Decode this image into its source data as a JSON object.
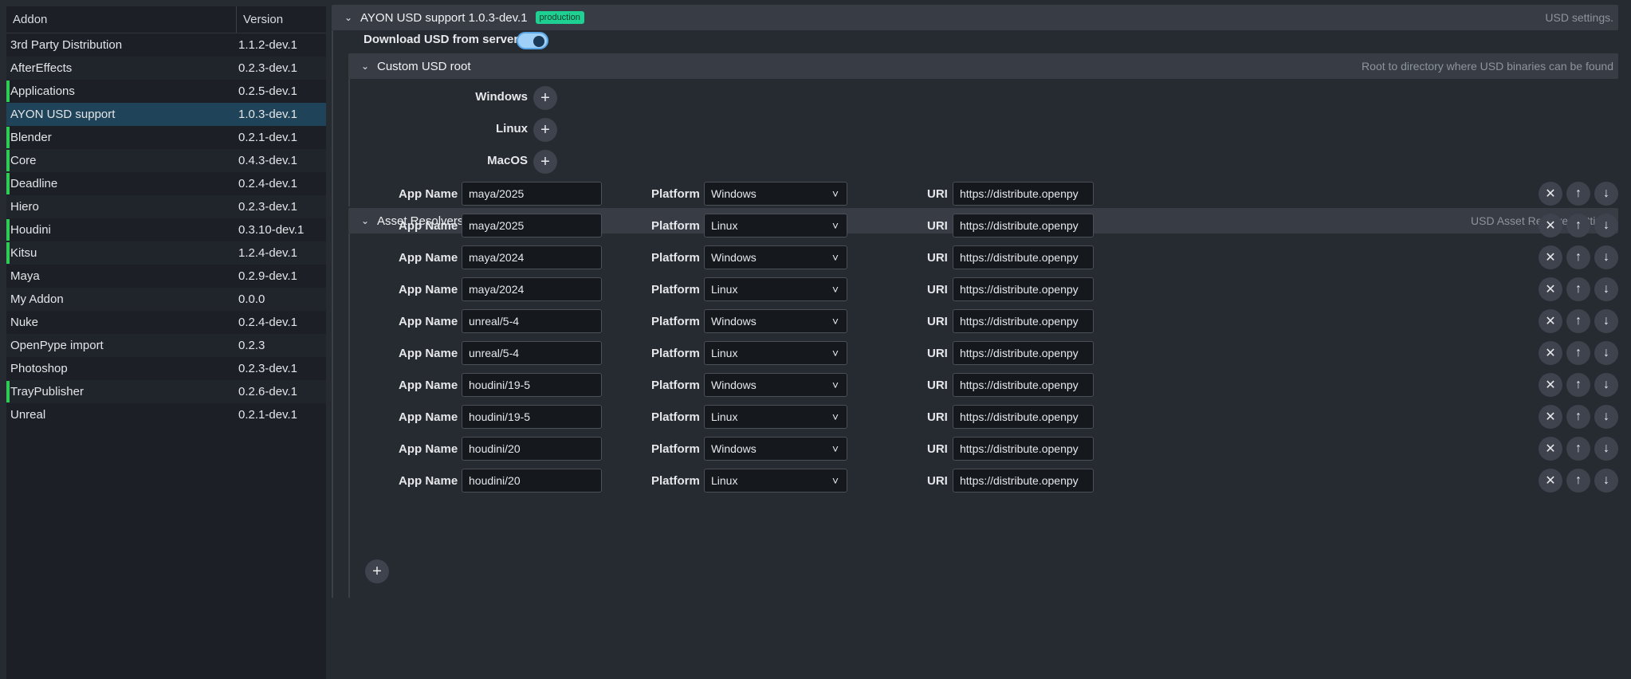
{
  "addons": {
    "header": {
      "name": "Addon",
      "version": "Version"
    },
    "rows": [
      {
        "name": "3rd Party Distribution",
        "version": "1.1.2-dev.1",
        "marked": false,
        "selected": false
      },
      {
        "name": "AfterEffects",
        "version": "0.2.3-dev.1",
        "marked": false,
        "selected": false
      },
      {
        "name": "Applications",
        "version": "0.2.5-dev.1",
        "marked": true,
        "selected": false
      },
      {
        "name": "AYON USD support",
        "version": "1.0.3-dev.1",
        "marked": false,
        "selected": true
      },
      {
        "name": "Blender",
        "version": "0.2.1-dev.1",
        "marked": true,
        "selected": false
      },
      {
        "name": "Core",
        "version": "0.4.3-dev.1",
        "marked": true,
        "selected": false
      },
      {
        "name": "Deadline",
        "version": "0.2.4-dev.1",
        "marked": true,
        "selected": false
      },
      {
        "name": "Hiero",
        "version": "0.2.3-dev.1",
        "marked": false,
        "selected": false
      },
      {
        "name": "Houdini",
        "version": "0.3.10-dev.1",
        "marked": true,
        "selected": false
      },
      {
        "name": "Kitsu",
        "version": "1.2.4-dev.1",
        "marked": true,
        "selected": false
      },
      {
        "name": "Maya",
        "version": "0.2.9-dev.1",
        "marked": false,
        "selected": false
      },
      {
        "name": "My Addon",
        "version": "0.0.0",
        "marked": false,
        "selected": false
      },
      {
        "name": "Nuke",
        "version": "0.2.4-dev.1",
        "marked": false,
        "selected": false
      },
      {
        "name": "OpenPype import",
        "version": "0.2.3",
        "marked": false,
        "selected": false
      },
      {
        "name": "Photoshop",
        "version": "0.2.3-dev.1",
        "marked": false,
        "selected": false
      },
      {
        "name": "TrayPublisher",
        "version": "0.2.6-dev.1",
        "marked": true,
        "selected": false
      },
      {
        "name": "Unreal",
        "version": "0.2.1-dev.1",
        "marked": false,
        "selected": false
      }
    ]
  },
  "settings": {
    "title": "AYON USD support 1.0.3-dev.1",
    "badge": "production",
    "hint": "USD settings.",
    "download": {
      "label": "Download USD from server",
      "enabled": true
    },
    "custom_root": {
      "title": "Custom USD root",
      "hint": "Root to directory where USD binaries can be found",
      "platforms": [
        "Windows",
        "Linux",
        "MacOS"
      ]
    },
    "resolvers": {
      "title": "Asset Resolvers",
      "hint": "USD Asset Resolver settings",
      "app_label": "App Name",
      "platform_label": "Platform",
      "uri_label": "URI",
      "items": [
        {
          "app": "maya/2025",
          "platform": "Windows",
          "uri": "https://distribute.openpy"
        },
        {
          "app": "maya/2025",
          "platform": "Linux",
          "uri": "https://distribute.openpy"
        },
        {
          "app": "maya/2024",
          "platform": "Windows",
          "uri": "https://distribute.openpy"
        },
        {
          "app": "maya/2024",
          "platform": "Linux",
          "uri": "https://distribute.openpy"
        },
        {
          "app": "unreal/5-4",
          "platform": "Windows",
          "uri": "https://distribute.openpy"
        },
        {
          "app": "unreal/5-4",
          "platform": "Linux",
          "uri": "https://distribute.openpy"
        },
        {
          "app": "houdini/19-5",
          "platform": "Windows",
          "uri": "https://distribute.openpy"
        },
        {
          "app": "houdini/19-5",
          "platform": "Linux",
          "uri": "https://distribute.openpy"
        },
        {
          "app": "houdini/20",
          "platform": "Windows",
          "uri": "https://distribute.openpy"
        },
        {
          "app": "houdini/20",
          "platform": "Linux",
          "uri": "https://distribute.openpy"
        }
      ]
    }
  },
  "colors": {
    "accent": "#5aa7e8",
    "marker": "#2ecc55",
    "badge": "#1fd093",
    "selected_row": "#1f4358"
  },
  "icons": {
    "chevron": "chevron-down-icon",
    "plus": "plus-icon",
    "remove": "close-icon",
    "up": "arrow-up-icon",
    "down": "arrow-down-icon"
  }
}
